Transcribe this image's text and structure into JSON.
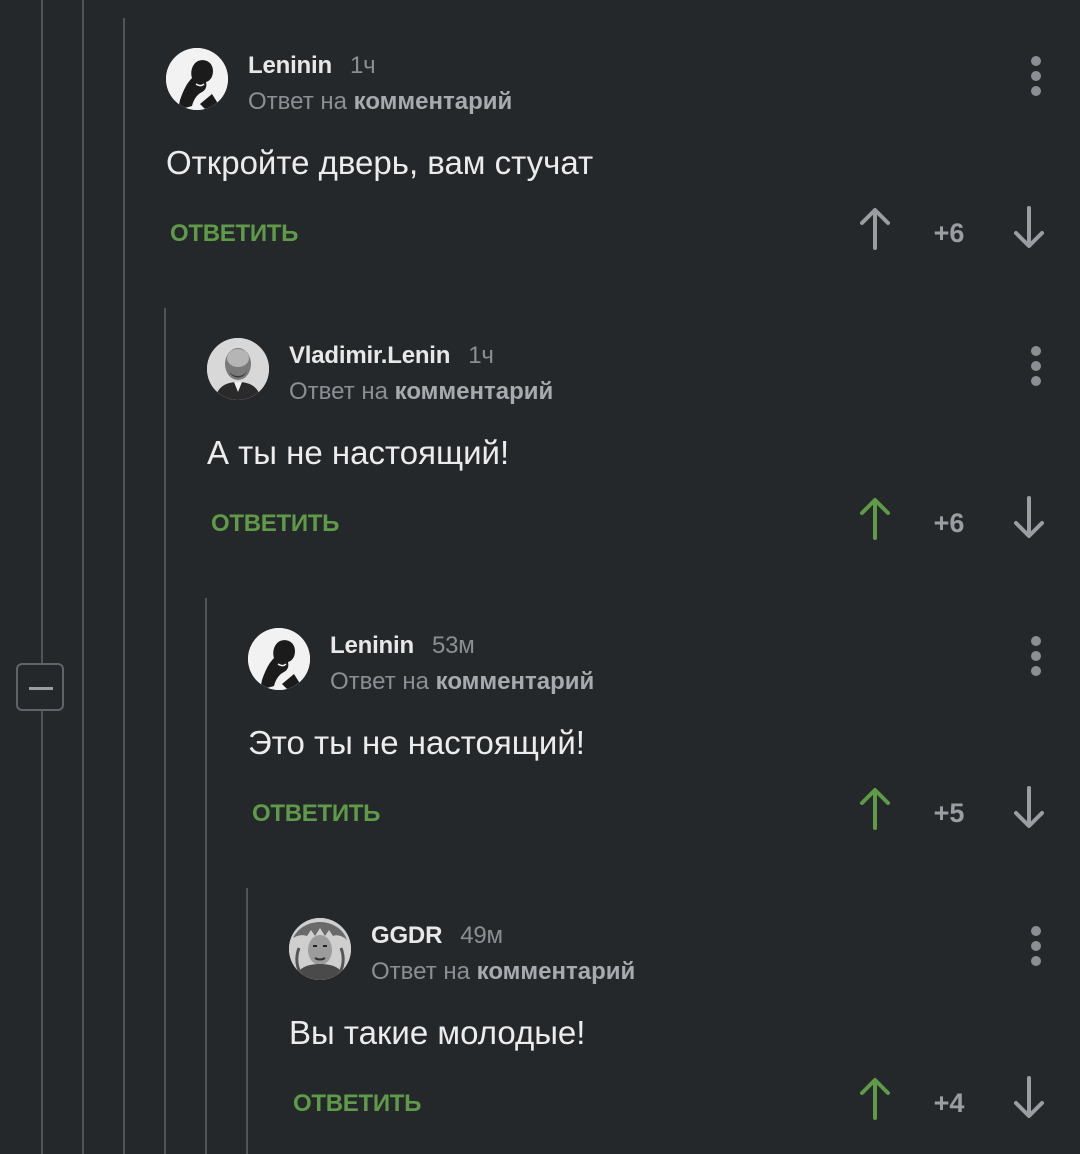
{
  "comments": [
    {
      "author": "Leninin",
      "time": "1ч",
      "reply_prefix": "Ответ на",
      "reply_target": "комментарий",
      "text": "Откройте дверь, вам стучат",
      "reply_label": "ОТВЕТИТЬ",
      "score": "+6",
      "upvoted": false
    },
    {
      "author": "Vladimir.Lenin",
      "time": "1ч",
      "reply_prefix": "Ответ на",
      "reply_target": "комментарий",
      "text": "А ты не настоящий!",
      "reply_label": "ОТВЕТИТЬ",
      "score": "+6",
      "upvoted": true
    },
    {
      "author": "Leninin",
      "time": "53м",
      "reply_prefix": "Ответ на",
      "reply_target": "комментарий",
      "text": "Это ты не настоящий!",
      "reply_label": "ОТВЕТИТЬ",
      "score": "+5",
      "upvoted": true
    },
    {
      "author": "GGDR",
      "time": "49м",
      "reply_prefix": "Ответ на",
      "reply_target": "комментарий",
      "text": "Вы такие молодые!",
      "reply_label": "ОТВЕТИТЬ",
      "score": "+4",
      "upvoted": true
    }
  ],
  "colors": {
    "background": "#25282b",
    "accent_green": "#5f9a48",
    "muted_text": "#8b8f94",
    "thread_line": "#50545a"
  }
}
